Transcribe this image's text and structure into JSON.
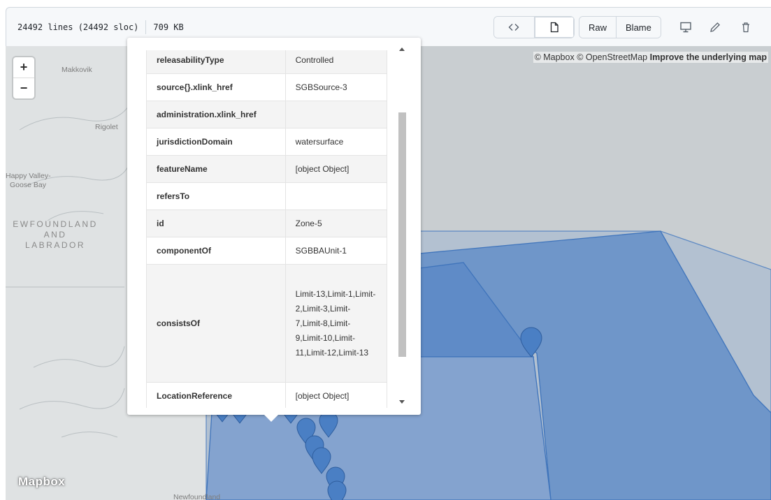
{
  "file_header": {
    "lines": "24492 lines (24492 sloc)",
    "size": "709 KB",
    "raw_label": "Raw",
    "blame_label": "Blame",
    "icons": [
      "code-icon",
      "file-icon",
      "desktop-icon",
      "pencil-icon",
      "trash-icon"
    ]
  },
  "map": {
    "attribution_prefix": "© Mapbox © OpenStreetMap",
    "attribution_link": "Improve the underlying map",
    "zoom_in": "+",
    "zoom_out": "−",
    "places": {
      "makkovik": "Makkovik",
      "rigolet": "Rigolet",
      "happy_valley": "Happy Valley-",
      "goose_bay": "Goose Bay",
      "region_line1": "EWFOUNDLAND",
      "region_line2": "AND",
      "region_line3": "LABRADOR",
      "newfoundland": "Newfoundland"
    },
    "logo": "Mapbox",
    "colors": {
      "land": "#c9ced1",
      "zone": "#6b93c9",
      "marker": "#4a7fc4"
    }
  },
  "popup": {
    "rows": [
      {
        "key": "releasabilityType",
        "value": "Controlled"
      },
      {
        "key": "source{}.xlink_href",
        "value": "SGBSource-3"
      },
      {
        "key": "administration.xlink_href",
        "value": ""
      },
      {
        "key": "jurisdictionDomain",
        "value": "watersurface"
      },
      {
        "key": "featureName",
        "value": "[object Object]"
      },
      {
        "key": "refersTo",
        "value": ""
      },
      {
        "key": "id",
        "value": "Zone-5"
      },
      {
        "key": "componentOf",
        "value": "SGBBAUnit-1"
      },
      {
        "key": "consistsOf",
        "value": "Limit-13,Limit-1,Limit-2,Limit-3,Limit-7,Limit-8,Limit-9,Limit-10,Limit-11,Limit-12,Limit-13"
      },
      {
        "key": "LocationReference",
        "value": "[object Object]"
      }
    ]
  }
}
